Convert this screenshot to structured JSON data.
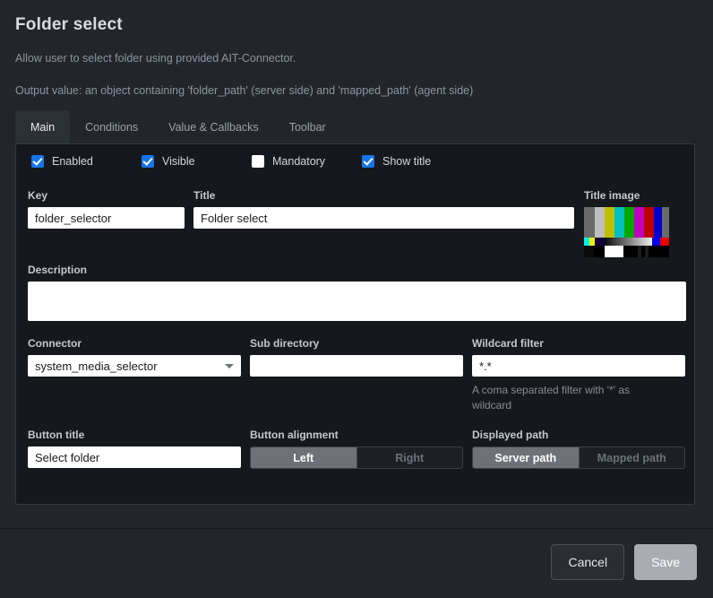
{
  "header": {
    "title": "Folder select",
    "description": "Allow user to select folder using provided AIT-Connector.",
    "output": "Output value: an object containing 'folder_path' (server side) and 'mapped_path' (agent side)"
  },
  "tabs": [
    {
      "label": "Main",
      "active": true
    },
    {
      "label": "Conditions",
      "active": false
    },
    {
      "label": "Value & Callbacks",
      "active": false
    },
    {
      "label": "Toolbar",
      "active": false
    }
  ],
  "checkboxes": [
    {
      "label": "Enabled",
      "checked": true
    },
    {
      "label": "Visible",
      "checked": true
    },
    {
      "label": "Mandatory",
      "checked": false
    },
    {
      "label": "Show title",
      "checked": true
    }
  ],
  "fields": {
    "key": {
      "label": "Key",
      "value": "folder_selector",
      "placeholder": ""
    },
    "title": {
      "label": "Title",
      "value": "Folder select",
      "placeholder": ""
    },
    "title_image": {
      "label": "Title image"
    },
    "description": {
      "label": "Description",
      "value": "",
      "placeholder": ""
    },
    "connector": {
      "label": "Connector",
      "value": "system_media_selector",
      "options": [
        "system_media_selector"
      ]
    },
    "sub_directory": {
      "label": "Sub directory",
      "value": "",
      "placeholder": ""
    },
    "wildcard": {
      "label": "Wildcard filter",
      "value": "*.*",
      "placeholder": "",
      "hint": "A coma separated filter with '*' as wildcard"
    },
    "button_title": {
      "label": "Button title",
      "value": "Select folder",
      "placeholder": ""
    },
    "button_alignment": {
      "label": "Button alignment",
      "options": [
        {
          "label": "Left",
          "selected": true
        },
        {
          "label": "Right",
          "selected": false
        }
      ]
    },
    "displayed_path": {
      "label": "Displayed path",
      "options": [
        {
          "label": "Server path",
          "selected": true
        },
        {
          "label": "Mapped path",
          "selected": false
        }
      ]
    }
  },
  "footer": {
    "cancel_label": "Cancel",
    "save_label": "Save"
  },
  "colors": {
    "accent_checkbox": "#1675ec",
    "page_background": "#22262c",
    "panel_background": "#15181c",
    "save_button": "#a9adb3",
    "segment_selected": "#6e7178"
  }
}
